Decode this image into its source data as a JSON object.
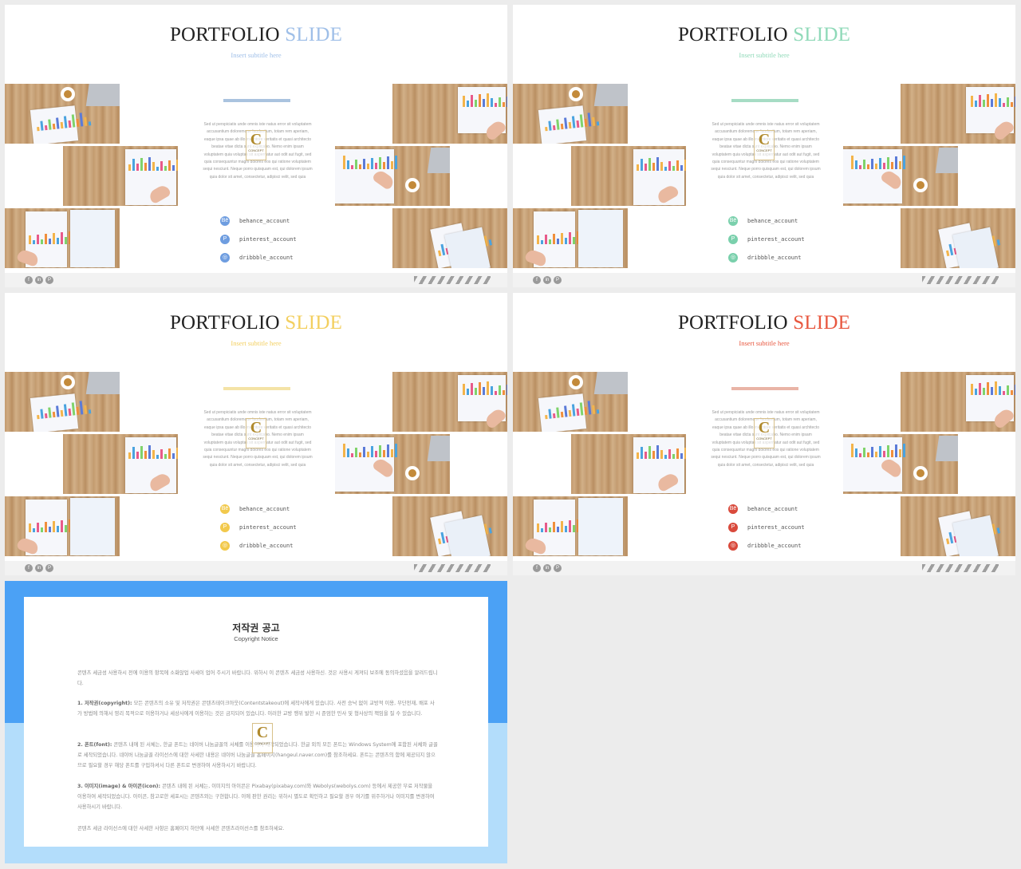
{
  "slides": [
    {
      "title_main": "PORTFOLIO",
      "title_accent": "SLIDE",
      "subtitle": "Insert subtitle here",
      "accent": "#9fbfe8",
      "divider_color": "#aac3df",
      "icon_color": "#6e9de0",
      "socials": [
        {
          "icon": "behance-icon",
          "glyph": "Bē",
          "label": "behance_account"
        },
        {
          "icon": "pinterest-icon",
          "glyph": "P",
          "label": "pinterest_account"
        },
        {
          "icon": "dribbble-icon",
          "glyph": "◎",
          "label": "dribbble_account"
        }
      ]
    },
    {
      "title_main": "PORTFOLIO",
      "title_accent": "SLIDE",
      "subtitle": "Insert subtitle here",
      "accent": "#8fd9b8",
      "divider_color": "#a6dcc4",
      "icon_color": "#7ad0ac",
      "socials": [
        {
          "icon": "behance-icon",
          "glyph": "Bē",
          "label": "behance_account"
        },
        {
          "icon": "pinterest-icon",
          "glyph": "P",
          "label": "pinterest_account"
        },
        {
          "icon": "dribbble-icon",
          "glyph": "◎",
          "label": "dribbble_account"
        }
      ]
    },
    {
      "title_main": "PORTFOLIO",
      "title_accent": "SLIDE",
      "subtitle": "Insert subtitle here",
      "accent": "#f3cf5f",
      "divider_color": "#f4e3a6",
      "icon_color": "#f2c94c",
      "socials": [
        {
          "icon": "behance-icon",
          "glyph": "Bē",
          "label": "behance_account"
        },
        {
          "icon": "pinterest-icon",
          "glyph": "P",
          "label": "pinterest_account"
        },
        {
          "icon": "dribbble-icon",
          "glyph": "◎",
          "label": "dribbble_account"
        }
      ]
    },
    {
      "title_main": "PORTFOLIO",
      "title_accent": "SLIDE",
      "subtitle": "Insert subtitle here",
      "accent": "#e8573f",
      "divider_color": "#e9b4a6",
      "icon_color": "#d94a3c",
      "socials": [
        {
          "icon": "behance-icon",
          "glyph": "Bē",
          "label": "behance_account"
        },
        {
          "icon": "pinterest-icon",
          "glyph": "P",
          "label": "pinterest_account"
        },
        {
          "icon": "dribbble-icon",
          "glyph": "◎",
          "label": "dribbble_account"
        }
      ]
    }
  ],
  "lorem": "Sed ut perspiciatis unde omnis iste natus error sit voluptatem accusantium doloremque laudantium, totam rem aperiam, eaque ipsa quae ab illo inventore veritatis et quasi architecto beatae vitae dicta sunt explicabo. Nemo enim ipsam voluptatem quia voluptas sit aspernatur aut odit aut fugit, sed quia consequuntur magni dolores eos qui ratione voluptatem sequi nesciunt. Neque porro quisquam est, qui dolorem ipsum quia dolor sit amet, consectetur, adipisci velit, sed quia",
  "logo": {
    "letter": "C",
    "text": "CONCEPT"
  },
  "footer_icons": [
    {
      "icon": "facebook-icon",
      "glyph": "f"
    },
    {
      "icon": "linkedin-icon",
      "glyph": "in"
    },
    {
      "icon": "pinterest-icon",
      "glyph": "P"
    }
  ],
  "notice": {
    "title": "저작권 공고",
    "subtitle": "Copyright Notice",
    "intro": "콘텐츠 세금성 사용하시 전에 이용의 항목에 소화않업 사세이 업어 주시기 바랍니다. 위하시 이 콘텐츠 세금성 사용하신. 것은 사용시 게져되 보조에 동의하셨음을 알려드립니다.",
    "p1_head": "1. 저작권(copyright):",
    "p1": " 모든 콘텐츠의 소유 및 저작권은 콘텐츠테이크아웃(Contentstakeout)에 세작사에게 있습니다. 사전 승낙 없이 교방적 이용, 무단전재, 배포 사가 방법에 의해서 영리 목적으로 이용하거나 세상사에게 이용하는 것은 금지되어 있습니다. 이러한 교방 행위 발한 시 준엄한 민사 및 형사상의 책임을 질 수 있습니다.",
    "p2_head": "2. 폰트(font):",
    "p2": " 콘텐츠 내에 된 서체는, 한글 폰트는 네이버 나눔글꼴의 서체를 이용하여 세작되었습니다. 한글 외의 모든 폰트는 Windows System에 포함된 서체와 글꼴로 세작되었습니다. 네이버 나눔글꼴 라이선스에 대한 사세한 내용은 네이버 나눔글꼴 홈페이지(hangeul.naver.com)를 참조하세요. 폰트는 콘텐츠의 함에 제공되지 않으므로 필요할 경우 해당 폰트를 구입하셔서 다른 폰트로 변경하여 사용하시기 바랍니다.",
    "p3_head": "3. 이미지(image) & 아이콘(icon):",
    "p3": " 콘텐츠 내에 된 서체는, 이미지의 아이콘은 Pixabay(pixabay.com)와 Webolys(webolys.com) 등에서 제공한 무료 저작물을 이용하여 세작되었습니다. 아이콘, 참고로한 세포시는 콘텐츠와는 구현합니다. 이에 판한 권리는 위하시 별도로 확인하고 필요할 경우 여기를 위주하거나 이미지를 변경하여 사용하시기 바랍니다.",
    "outro": "콘텐츠 세금 라이선스에 대한 사세한 사항은 홈페이지 하단에 사세한 콘텐츠라이선스를 참조하세요."
  }
}
